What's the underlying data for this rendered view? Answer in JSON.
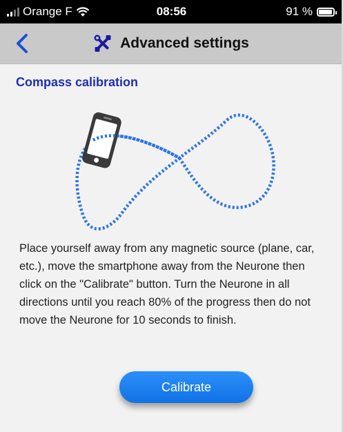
{
  "status_bar": {
    "carrier": "Orange F",
    "time": "08:56",
    "battery": "91 %",
    "battery_level": 0.91
  },
  "nav": {
    "title": "Advanced settings",
    "back_icon": "chevron-left-icon",
    "title_icon": "tools-icon"
  },
  "calibration": {
    "title": "Compass calibration",
    "instructions": "Place yourself away from any magnetic source (plane, car, etc.), move the smartphone away from the Neurone then click on the \"Calibrate\" button. Turn the Neurone in all directions until you reach 80% of the progress then do not move the Neurone for 10 seconds to finish.",
    "button_label": "Calibrate"
  },
  "colors": {
    "accent": "#1a7ff0",
    "section_title": "#1f2fb0",
    "nav_bg": "#c9c9c9",
    "back_chevron": "#1a4fd6"
  }
}
